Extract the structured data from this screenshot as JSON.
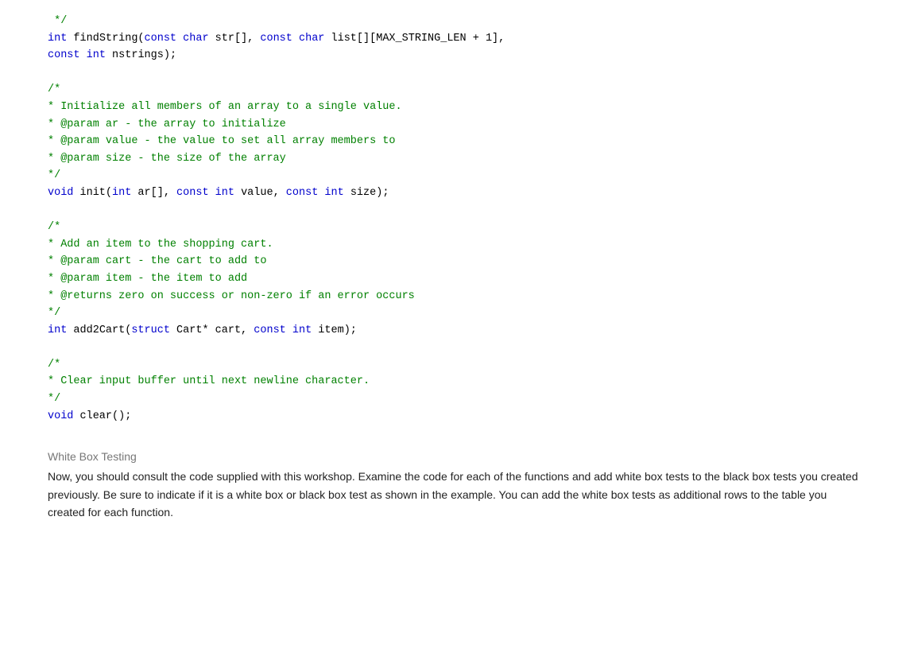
{
  "code": {
    "sections": [
      {
        "id": "findString",
        "lines": [
          {
            "type": "comment",
            "text": " */"
          },
          {
            "type": "mixed",
            "parts": [
              {
                "cls": "kw",
                "text": "int"
              },
              {
                "cls": "plain",
                "text": " findString("
              },
              {
                "cls": "kw",
                "text": "const"
              },
              {
                "cls": "plain",
                "text": " "
              },
              {
                "cls": "kw",
                "text": "char"
              },
              {
                "cls": "plain",
                "text": " str[], "
              },
              {
                "cls": "kw",
                "text": "const"
              },
              {
                "cls": "plain",
                "text": " "
              },
              {
                "cls": "kw",
                "text": "char"
              },
              {
                "cls": "plain",
                "text": " list[][MAX_STRING_LEN + 1],"
              }
            ]
          },
          {
            "type": "mixed",
            "parts": [
              {
                "cls": "kw",
                "text": "const"
              },
              {
                "cls": "plain",
                "text": " "
              },
              {
                "cls": "kw",
                "text": "int"
              },
              {
                "cls": "plain",
                "text": " nstrings);"
              }
            ]
          }
        ]
      }
    ],
    "block1": [
      "/*",
      "* Initialize all members of an array to a single value.",
      "* @param ar - the array to initialize",
      "* @param value - the value to set all array members to",
      "* @param size - the size of the array",
      "*/"
    ],
    "block1_sig": "void init(int ar[], const int value, const int size);",
    "block2": [
      "/*",
      "* Add an item to the shopping cart.",
      "* @param cart - the cart to add to",
      "* @param item - the item to add",
      "* @returns zero on success or non-zero if an error occurs",
      "*/"
    ],
    "block2_sig": "int add2Cart(struct Cart* cart, const int item);",
    "block3": [
      "/*",
      "* Clear input buffer until next newline character.",
      "*/"
    ],
    "block3_sig": "void clear();"
  },
  "prose": {
    "heading": "White Box Testing",
    "body": "Now, you should consult the code supplied with this workshop. Examine the code for each of the functions and add white box tests to the black box tests you created previously. Be sure to indicate if it is a white box or black box test as shown in the example. You can add the white box tests as additional rows to the table you created for each function."
  }
}
